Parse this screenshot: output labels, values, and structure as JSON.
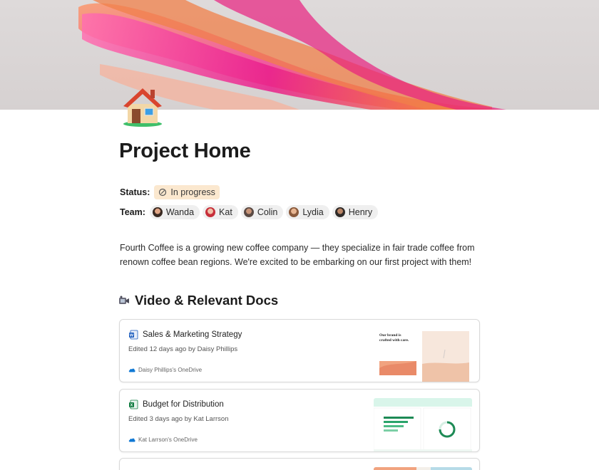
{
  "page": {
    "title": "Project Home"
  },
  "properties": {
    "status_label": "Status:",
    "status_value": "In progress",
    "team_label": "Team:",
    "team": [
      {
        "name": "Wanda"
      },
      {
        "name": "Kat"
      },
      {
        "name": "Colin"
      },
      {
        "name": "Lydia"
      },
      {
        "name": "Henry"
      }
    ]
  },
  "description": "Fourth Coffee is a growing new coffee company — they specialize in fair trade coffee from renown coffee bean regions. We're excited to be embarking on our first project with them!",
  "section": {
    "heading": "Video & Relevant Docs"
  },
  "docs": [
    {
      "title": "Sales & Marketing Strategy",
      "meta": "Edited 12 days ago by Daisy Phillips",
      "source": "Daisy Phillips's OneDrive",
      "app_icon": "word-icon",
      "thumb_text": "Our brand is crafted with care."
    },
    {
      "title": "Budget for Distribution",
      "meta": "Edited 3 days ago by Kat Larrson",
      "source": "Kat Larrson's OneDrive",
      "app_icon": "excel-icon"
    }
  ],
  "colors": {
    "status_bg": "#fbe8cf",
    "word_blue": "#185abd",
    "excel_green": "#107c41",
    "onedrive_blue": "#0f78d4"
  }
}
